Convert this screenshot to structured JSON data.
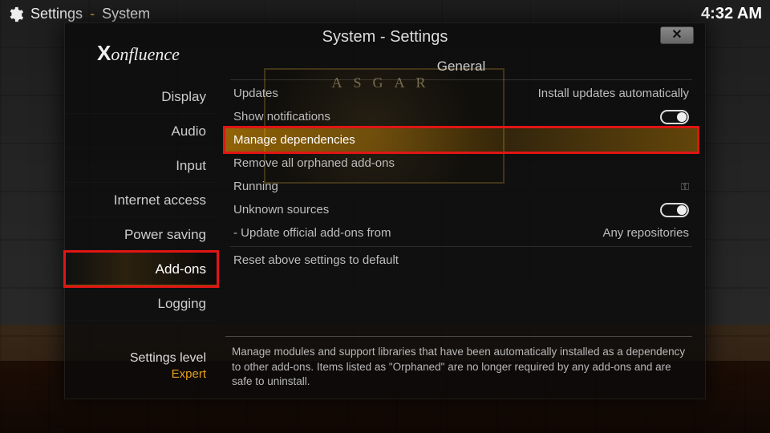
{
  "breadcrumb": {
    "root": "Settings",
    "sub": "System"
  },
  "clock": "4:32 AM",
  "brand": {
    "prefix": "X",
    "suffix": "onfluence"
  },
  "panel": {
    "title": "System - Settings"
  },
  "thumb": {
    "title": "ASGAR"
  },
  "sidebar": {
    "items": [
      {
        "label": "Display"
      },
      {
        "label": "Audio"
      },
      {
        "label": "Input"
      },
      {
        "label": "Internet access"
      },
      {
        "label": "Power saving"
      },
      {
        "label": "Add-ons",
        "selected": true
      },
      {
        "label": "Logging"
      }
    ]
  },
  "settings_level": {
    "label": "Settings level",
    "value": "Expert"
  },
  "content": {
    "section": "General",
    "rows": [
      {
        "label": "Updates",
        "value": "Install updates automatically",
        "type": "select"
      },
      {
        "label": "Show notifications",
        "type": "toggle",
        "on": true
      },
      {
        "label": "Manage dependencies",
        "type": "action",
        "highlight": true
      },
      {
        "label": "Remove all orphaned add-ons",
        "type": "action"
      },
      {
        "label": "Running",
        "type": "action",
        "icon": "key"
      },
      {
        "label": "Unknown sources",
        "type": "toggle",
        "on": true
      },
      {
        "label": "- Update official add-ons from",
        "value": "Any repositories",
        "type": "select"
      },
      {
        "label": "Reset above settings to default",
        "type": "action"
      }
    ]
  },
  "description": "Manage modules and support libraries that have been automatically installed as a dependency to other add-ons. Items listed as \"Orphaned\" are no longer required by any add-ons and are safe to uninstall."
}
